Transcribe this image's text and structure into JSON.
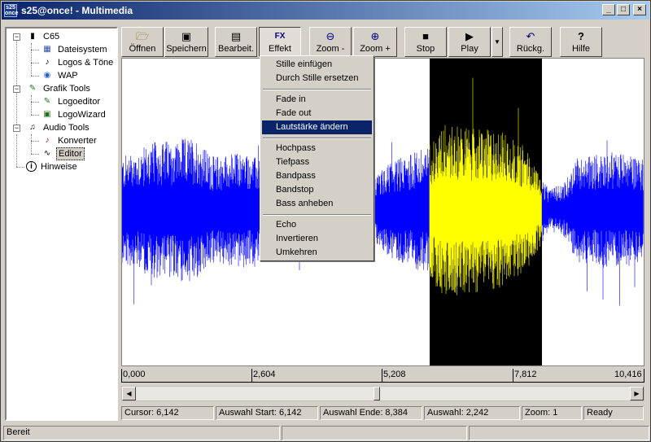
{
  "window": {
    "title": "s25@once! - Multimedia",
    "icon_text": "s25 once"
  },
  "tree": {
    "items": [
      {
        "label": "C65",
        "icon": "phone-icon"
      },
      {
        "label": "Dateisystem",
        "icon": "filesystem-icon"
      },
      {
        "label": "Logos & Töne",
        "icon": "logos-tones-icon"
      },
      {
        "label": "WAP",
        "icon": "wap-icon"
      },
      {
        "label": "Grafik Tools",
        "icon": "graphics-tools-icon"
      },
      {
        "label": "Logoeditor",
        "icon": "logo-editor-icon"
      },
      {
        "label": "LogoWizard",
        "icon": "logo-wizard-icon"
      },
      {
        "label": "Audio Tools",
        "icon": "audio-tools-icon"
      },
      {
        "label": "Konverter",
        "icon": "converter-icon"
      },
      {
        "label": "Editor",
        "icon": "audio-editor-icon"
      },
      {
        "label": "Hinweise",
        "icon": "info-icon"
      }
    ]
  },
  "toolbar": {
    "open": "Öffnen",
    "save": "Speichern",
    "edit": "Bearbeit.",
    "effect": "Effekt",
    "effect_icon_text": "FX",
    "zoom_out": "Zoom -",
    "zoom_in": "Zoom +",
    "stop": "Stop",
    "play": "Play",
    "undo": "Rückg.",
    "help": "Hilfe"
  },
  "effect_menu": {
    "items": [
      "Stille einfügen",
      "Durch Stille ersetzen",
      "Fade in",
      "Fade out",
      "Lautstärke ändern",
      "Hochpass",
      "Tiefpass",
      "Bandpass",
      "Bandstop",
      "Bass anheben",
      "Echo",
      "Invertieren",
      "Umkehren"
    ],
    "highlighted": "Lautstärke ändern"
  },
  "waveform": {
    "colors": {
      "wave": "#0000ff",
      "selected_wave": "#ffff00",
      "selection_bg": "#000000",
      "background": "#ffffff"
    },
    "duration": 10.416,
    "selection_start": 6.142,
    "selection_end": 8.384
  },
  "ruler": {
    "labels": [
      "0,000",
      "2,604",
      "5,208",
      "7,812",
      "10,416"
    ]
  },
  "info": {
    "cursor": "Cursor: 6,142",
    "sel_start": "Auswahl Start: 6,142",
    "sel_end": "Auswahl Ende: 8,384",
    "sel_len": "Auswahl: 2,242",
    "zoom": "Zoom: 1",
    "state": "Ready"
  },
  "status": {
    "text": "Bereit"
  }
}
